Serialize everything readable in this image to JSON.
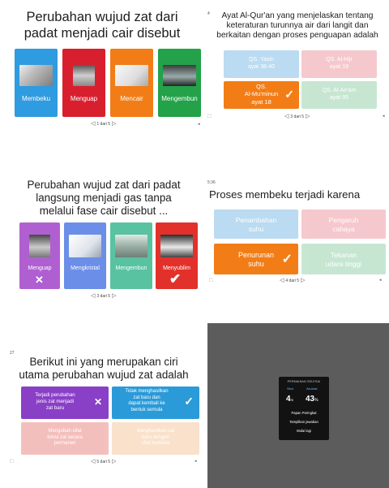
{
  "panels": [
    {
      "title": "Perubahan wujud zat dari\npadat menjadi cair disebut",
      "options": [
        {
          "label": "Membeku",
          "color": "#2f9be0"
        },
        {
          "label": "Menguap",
          "color": "#d81f2e"
        },
        {
          "label": "Mencair",
          "color": "#f27d16"
        },
        {
          "label": "Mengembun",
          "color": "#23a249"
        }
      ],
      "pager": "1 dari 5"
    },
    {
      "number": "4",
      "title": "Ayat Al-Qur'an yang menjelaskan tentang\nketeraturan turunnya air dari langit dan\nberkaitan dengan proses penguapan adalah",
      "options": [
        {
          "label": "QS. Yasin\nayat 38-40",
          "color": "#4da3dc",
          "state": "faded"
        },
        {
          "label": "QS. Al-Hijr\nayat 19",
          "color": "#e6707e",
          "state": "faded"
        },
        {
          "label": "QS.\nAl-Mu'minun\nayat 18",
          "color": "#f27d16",
          "state": "correct"
        },
        {
          "label": "QS. Al-An'am\nayat 95",
          "color": "#6cc08a",
          "state": "faded"
        }
      ],
      "pager": "3 dari 5"
    },
    {
      "title": "Perubahan wujud zat dari padat\nlangsung menjadi gas tanpa\nmelalui fase cair disebut ...",
      "options": [
        {
          "label": "Menguap",
          "color": "#b05fd1",
          "state": "wrong"
        },
        {
          "label": "Mengkristal",
          "color": "#6b8ee8",
          "state": "plain"
        },
        {
          "label": "Mengembun",
          "color": "#58c2a1",
          "state": "plain"
        },
        {
          "label": "Menyublim",
          "color": "#e2312b",
          "state": "correct"
        }
      ],
      "pager": "3 dari 5"
    },
    {
      "number": "5:36",
      "title": "Proses membeku terjadi karena",
      "options": [
        {
          "label": "Penambahan\nsuhu",
          "color": "#4da3dc",
          "state": "faded"
        },
        {
          "label": "Pengaruh\ncahaya",
          "color": "#e6707e",
          "state": "faded"
        },
        {
          "label": "Penurunan\nsuhu",
          "color": "#f27d16",
          "state": "correct"
        },
        {
          "label": "Tekanan\nudara tinggi",
          "color": "#6cc08a",
          "state": "faded"
        }
      ],
      "pager": "4 dari 5"
    },
    {
      "number": "27",
      "title": "Berikut ini yang merupakan ciri\nutama perubahan wujud zat adalah",
      "options": [
        {
          "label": "Terjadi perubahan\njenis zat menjadi\nzat baru",
          "color": "#8a3fc7",
          "state": "wrong"
        },
        {
          "label": "Tidak menghasilkan\nzat baru dan\ndapat kembali ke\nbentuk semula",
          "color": "#2a9ad8",
          "state": "correct"
        },
        {
          "label": "Mengubah sifat\nkimia zat secara\npermanen",
          "color": "#e25a52",
          "state": "faded"
        },
        {
          "label": "Menghasilkan zat\nbaru dengan\nsifat berbeda",
          "color": "#f1b37a",
          "state": "faded"
        }
      ],
      "pager": "5 dari 5"
    }
  ],
  "results": {
    "title": "PERMAINAN SELESAI",
    "score_label": "Skor",
    "score_value": "4",
    "score_total": "/5",
    "accuracy_label": "Akurasi",
    "accuracy_value": "43",
    "accuracy_unit": "%",
    "buttons": [
      "Papan Peringkat",
      "Tampilkan jawaban",
      "Mulai lagi"
    ]
  }
}
